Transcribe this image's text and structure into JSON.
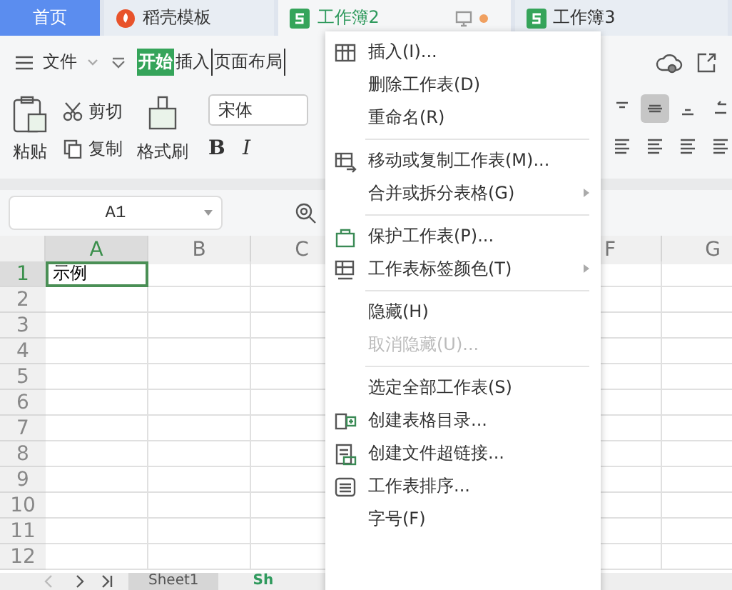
{
  "tabs": [
    {
      "label": "首页",
      "kind": "home",
      "selected": false,
      "modified": false
    },
    {
      "label": "稻壳模板",
      "kind": "docer",
      "selected": false,
      "modified": false
    },
    {
      "label": "工作簿2",
      "kind": "sheet",
      "selected": true,
      "modified": true
    },
    {
      "label": "工作簿3",
      "kind": "sheet",
      "selected": false,
      "modified": false
    }
  ],
  "toolbar": {
    "file_menu": "文件",
    "ribbon_tabs": [
      {
        "label": "开始",
        "selected": true
      },
      {
        "label": "插入",
        "selected": false
      },
      {
        "label": "页面布局",
        "selected": false
      }
    ]
  },
  "ribbon": {
    "paste": "粘贴",
    "cut": "剪切",
    "copy": "复制",
    "format_painter": "格式刷",
    "font": "宋体",
    "bold": "B",
    "italic": "I"
  },
  "name_box": "A1",
  "columns": [
    {
      "label": "A",
      "selected": true
    },
    {
      "label": "B",
      "selected": false
    },
    {
      "label": "C",
      "selected": false
    },
    {
      "label": "F",
      "selected": false
    },
    {
      "label": "G",
      "selected": false
    }
  ],
  "rows": [
    {
      "number": "1",
      "selected": true,
      "cells": [
        "示例"
      ]
    },
    {
      "number": "2",
      "selected": false,
      "cells": []
    },
    {
      "number": "3",
      "selected": false,
      "cells": []
    },
    {
      "number": "4",
      "selected": false,
      "cells": []
    },
    {
      "number": "5",
      "selected": false,
      "cells": []
    },
    {
      "number": "6",
      "selected": false,
      "cells": []
    },
    {
      "number": "7",
      "selected": false,
      "cells": []
    },
    {
      "number": "8",
      "selected": false,
      "cells": []
    },
    {
      "number": "9",
      "selected": false,
      "cells": []
    },
    {
      "number": "10",
      "selected": false,
      "cells": []
    },
    {
      "number": "11",
      "selected": false,
      "cells": []
    },
    {
      "number": "12",
      "selected": false,
      "cells": []
    }
  ],
  "sheet_tabs": [
    {
      "label": "Sheet1",
      "selected": false
    },
    {
      "label": "Sh",
      "selected": true
    }
  ],
  "context_menu": [
    {
      "kind": "item",
      "label": "插入(I)...",
      "disabled": false,
      "submenu": false
    },
    {
      "kind": "item",
      "label": "删除工作表(D)",
      "disabled": false,
      "submenu": false
    },
    {
      "kind": "item",
      "label": "重命名(R)",
      "disabled": false,
      "submenu": false
    },
    {
      "kind": "separator"
    },
    {
      "kind": "item",
      "label": "移动或复制工作表(M)...",
      "disabled": false,
      "submenu": false
    },
    {
      "kind": "item",
      "label": "合并或拆分表格(G)",
      "disabled": false,
      "submenu": true
    },
    {
      "kind": "separator"
    },
    {
      "kind": "item",
      "label": "保护工作表(P)...",
      "disabled": false,
      "submenu": false
    },
    {
      "kind": "item",
      "label": "工作表标签颜色(T)",
      "disabled": false,
      "submenu": true
    },
    {
      "kind": "separator"
    },
    {
      "kind": "item",
      "label": "隐藏(H)",
      "disabled": false,
      "submenu": false
    },
    {
      "kind": "item",
      "label": "取消隐藏(U)...",
      "disabled": true,
      "submenu": false
    },
    {
      "kind": "separator"
    },
    {
      "kind": "item",
      "label": "选定全部工作表(S)",
      "disabled": false,
      "submenu": false
    },
    {
      "kind": "item",
      "label": "创建表格目录...",
      "disabled": false,
      "submenu": false
    },
    {
      "kind": "item",
      "label": "创建文件超链接...",
      "disabled": false,
      "submenu": false
    },
    {
      "kind": "item",
      "label": "工作表排序...",
      "disabled": false,
      "submenu": false
    },
    {
      "kind": "item",
      "label": "字号(F)",
      "disabled": false,
      "submenu": false
    }
  ]
}
